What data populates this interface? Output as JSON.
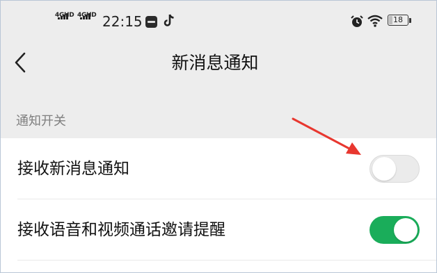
{
  "status_bar": {
    "signal_1": "4GHD",
    "signal_2": "4GHD",
    "time": "22:15",
    "app_icons": [
      "youku-icon",
      "tiktok-icon"
    ],
    "system_icons": [
      "alarm-icon",
      "wifi-icon"
    ],
    "battery_text": "18",
    "battery_percent": 18
  },
  "header": {
    "back_icon": "chevron-left-icon",
    "title": "新消息通知"
  },
  "section": {
    "title": "通知开关"
  },
  "settings": [
    {
      "label": "接收新消息通知",
      "enabled": false
    },
    {
      "label": "接收语音和视频通话邀请提醒",
      "enabled": true
    }
  ],
  "colors": {
    "toggle_on": "#1aad5a",
    "toggle_off": "#ebebeb",
    "annotation_arrow": "#e8372f",
    "page_background": "#ededed"
  }
}
